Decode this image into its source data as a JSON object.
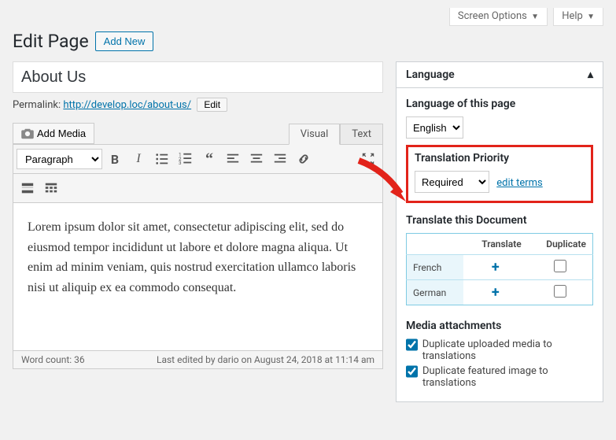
{
  "top_tabs": {
    "screen_options": "Screen Options",
    "help": "Help"
  },
  "header": {
    "title": "Edit Page",
    "add_new": "Add New"
  },
  "title_field": {
    "value": "About Us"
  },
  "permalink": {
    "label": "Permalink:",
    "url_text": "http://develop.loc/about-us/",
    "edit": "Edit"
  },
  "media": {
    "add": "Add Media"
  },
  "editor_tabs": {
    "visual": "Visual",
    "text": "Text"
  },
  "toolbar": {
    "format_select": "Paragraph"
  },
  "content": {
    "body": "Lorem ipsum dolor sit amet, consectetur adipiscing elit, sed do eiusmod tempor incididunt ut labore et dolore magna aliqua. Ut enim ad minim veniam, quis nostrud exercitation ullamco laboris nisi ut aliquip ex ea commodo consequat."
  },
  "footer": {
    "word_count": "Word count: 36",
    "last_edited": "Last edited by dario on August 24, 2018 at 11:14 am"
  },
  "sidebar": {
    "language_panel": "Language",
    "lang_of_page": {
      "heading": "Language of this page",
      "value": "English"
    },
    "priority": {
      "heading": "Translation Priority",
      "value": "Required",
      "edit_terms": "edit terms"
    },
    "translate_doc": {
      "heading": "Translate this Document",
      "th_translate": "Translate",
      "th_duplicate": "Duplicate",
      "rows": [
        {
          "lang": "French"
        },
        {
          "lang": "German"
        }
      ]
    },
    "media_attach": {
      "heading": "Media attachments",
      "chk_dup_uploaded": "Duplicate uploaded media to translations",
      "chk_dup_featured": "Duplicate featured image to translations"
    }
  }
}
